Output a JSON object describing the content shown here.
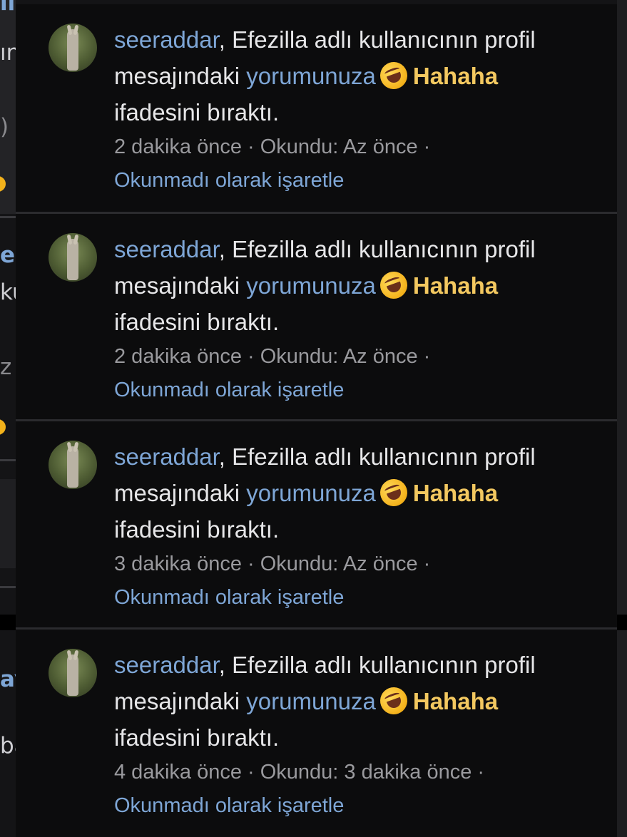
{
  "background": {
    "fragments": [
      "il",
      "ın",
      ") (",
      "e",
      "ku",
      "z ö",
      "ay",
      "ba"
    ]
  },
  "notifications": [
    {
      "user": "seeraddar",
      "text_before": ", Efezilla adlı kullanıcının profil",
      "text_line2_prefix": "mesajındaki ",
      "link": "yorumunuza",
      "reaction": "Hahaha",
      "text_line3": "ifadesini bıraktı.",
      "meta": "2 dakika önce · Okundu: Az önce ·",
      "action": "Okunmadı olarak işaretle"
    },
    {
      "user": "seeraddar",
      "text_before": ", Efezilla adlı kullanıcının profil",
      "text_line2_prefix": "mesajındaki ",
      "link": "yorumunuza",
      "reaction": "Hahaha",
      "text_line3": "ifadesini bıraktı.",
      "meta": "2 dakika önce · Okundu: Az önce ·",
      "action": "Okunmadı olarak işaretle"
    },
    {
      "user": "seeraddar",
      "text_before": ", Efezilla adlı kullanıcının profil",
      "text_line2_prefix": "mesajındaki ",
      "link": "yorumunuza",
      "reaction": "Hahaha",
      "text_line3": "ifadesini bıraktı.",
      "meta": "3 dakika önce · Okundu: Az önce ·",
      "action": "Okunmadı olarak işaretle"
    },
    {
      "user": "seeraddar",
      "text_before": ", Efezilla adlı kullanıcının profil",
      "text_line2_prefix": "mesajındaki ",
      "link": "yorumunuza",
      "reaction": "Hahaha",
      "text_line3": "ifadesini bıraktı.",
      "meta": "4 dakika önce · Okundu: 3 dakika önce ·",
      "action": "Okunmadı olarak işaretle"
    }
  ],
  "icons": {
    "reaction_emoji": "rolling-on-floor-laughing-icon",
    "avatar": "user-avatar-donkey"
  }
}
